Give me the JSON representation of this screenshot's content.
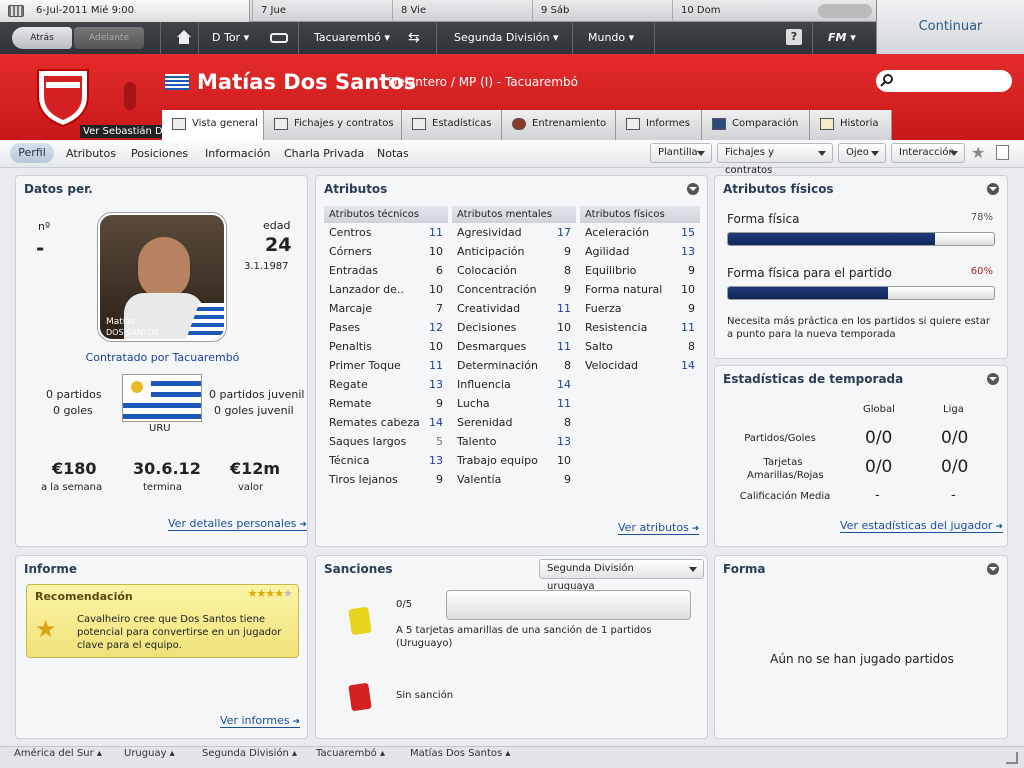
{
  "topbar": {
    "current_date": "6-Jul-2011 Mié 9:00",
    "days": [
      "7 Jue",
      "8 Vie",
      "9 Sáb",
      "10 Dom"
    ],
    "back_label": "Atrás",
    "forward_label": "Adelante",
    "manager": "D Tor",
    "club": "Tacuarembó",
    "league": "Segunda División",
    "world": "Mundo",
    "help": "?",
    "fm_logo": "FM",
    "continue_label": "Continuar"
  },
  "player": {
    "name": "Matías Dos Santos",
    "position_club": "Delantero / MP (I) - Tacuarembó",
    "nationality_flag": "Uruguay",
    "tooltip": "Ver Sebastián Dutra"
  },
  "tabs": [
    "Vista general",
    "Fichajes y contratos",
    "Estadísticas",
    "Entrenamiento",
    "Informes",
    "Comparación",
    "Historia"
  ],
  "subnav": {
    "items": [
      "Perfil",
      "Atributos",
      "Posiciones",
      "Información",
      "Charla Privada",
      "Notas"
    ],
    "dropdowns": [
      "Plantilla",
      "Fichajes y contratos",
      "Ojeo",
      "Interacción"
    ]
  },
  "datos": {
    "title": "Datos per.",
    "num_label": "nº",
    "num_value": "-",
    "edad_label": "edad",
    "edad_value": "24",
    "dob": "3.1.1987",
    "photo_caption_1": "Matías",
    "photo_caption_2": "DOS SANTOS",
    "contratado": "Contratado por Tacuarembó",
    "partidos": "0 partidos",
    "goles": "0 goles",
    "partidos_juvenil": "0 partidos juvenil",
    "goles_juvenil": "0 goles juvenil",
    "nation_code": "URU",
    "salary_value": "€180",
    "salary_label": "a la semana",
    "contract_value": "30.6.12",
    "contract_label": "termina",
    "value_value": "€12m",
    "value_label": "valor",
    "link": "Ver detalles personales"
  },
  "atributos": {
    "title": "Atributos",
    "tecnicos_label": "Atributos técnicos",
    "mentales_label": "Atributos mentales",
    "fisicos_label": "Atributos físicos",
    "tecnicos": [
      [
        "Centros",
        "11"
      ],
      [
        "Córners",
        "10"
      ],
      [
        "Entradas",
        "6"
      ],
      [
        "Lanzador de..",
        "10"
      ],
      [
        "Marcaje",
        "7"
      ],
      [
        "Pases",
        "12"
      ],
      [
        "Penaltis",
        "10"
      ],
      [
        "Primer Toque",
        "11"
      ],
      [
        "Regate",
        "13"
      ],
      [
        "Remate",
        "9"
      ],
      [
        "Remates cabeza",
        "14"
      ],
      [
        "Saques largos",
        "5"
      ],
      [
        "Técnica",
        "13"
      ],
      [
        "Tiros lejanos",
        "9"
      ]
    ],
    "mentales": [
      [
        "Agresividad",
        "17"
      ],
      [
        "Anticipación",
        "9"
      ],
      [
        "Colocación",
        "8"
      ],
      [
        "Concentración",
        "9"
      ],
      [
        "Creatividad",
        "11"
      ],
      [
        "Decisiones",
        "10"
      ],
      [
        "Desmarques",
        "11"
      ],
      [
        "Determinación",
        "8"
      ],
      [
        "Influencia",
        "14"
      ],
      [
        "Lucha",
        "11"
      ],
      [
        "Serenidad",
        "8"
      ],
      [
        "Talento",
        "13"
      ],
      [
        "Trabajo equipo",
        "10"
      ],
      [
        "Valentía",
        "9"
      ]
    ],
    "fisicos": [
      [
        "Aceleración",
        "15"
      ],
      [
        "Agilidad",
        "13"
      ],
      [
        "Equilibrio",
        "9"
      ],
      [
        "Forma natural",
        "10"
      ],
      [
        "Fuerza",
        "9"
      ],
      [
        "Resistencia",
        "11"
      ],
      [
        "Salto",
        "8"
      ],
      [
        "Velocidad",
        "14"
      ]
    ],
    "link": "Ver atributos"
  },
  "fisicos_panel": {
    "title": "Atributos físicos",
    "forma_label": "Forma física",
    "forma_pct": "78%",
    "forma_value": 78,
    "partido_label": "Forma física para el partido",
    "partido_pct": "60%",
    "partido_value": 60,
    "note": "Necesita más práctica en los partidos si quiere estar a punto para la nueva temporada",
    "pct_color_ok": "#555555",
    "pct_color_warn": "#b22222"
  },
  "estadisticas": {
    "title": "Estadísticas de temporada",
    "col_global": "Global",
    "col_liga": "Liga",
    "rows": [
      [
        "Partidos/Goles",
        "0/0",
        "0/0"
      ],
      [
        "Tarjetas Amarillas/Rojas",
        "0/0",
        "0/0"
      ],
      [
        "Calificación Media",
        "-",
        "-"
      ]
    ],
    "link": "Ver estadísticas del jugador"
  },
  "informe": {
    "title": "Informe",
    "rec_title": "Recomendación",
    "stars": 4,
    "text": "Cavalheiro cree que Dos Santos tiene potencial para convertirse en un jugador clave para el equipo.",
    "link": "Ver informes"
  },
  "sanciones": {
    "title": "Sanciones",
    "league": "Segunda División uruguaya",
    "yellow_count": "0/5",
    "yellow_text": "A 5 tarjetas amarillas de una sanción de 1 partidos (Uruguayo)",
    "red_text": "Sin sanción"
  },
  "forma": {
    "title": "Forma",
    "empty": "Aún no se han jugado partidos"
  },
  "breadcrumbs": [
    "América del Sur",
    "Uruguay",
    "Segunda División",
    "Tacuarembó",
    "Matías Dos Santos"
  ],
  "colors": {
    "header_red": "#d42022",
    "accent_blue": "#1c4f9c",
    "bar_navy": "#1f3c7a"
  }
}
